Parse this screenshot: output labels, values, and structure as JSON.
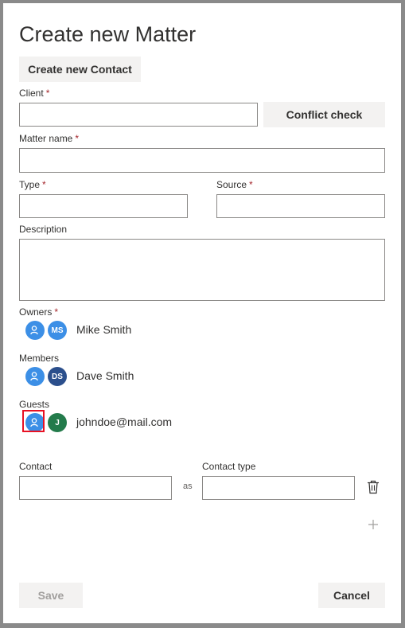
{
  "dialog": {
    "title": "Create new Matter",
    "create_contact_label": "Create new Contact",
    "conflict_check_label": "Conflict check",
    "save_label": "Save",
    "cancel_label": "Cancel"
  },
  "fields": {
    "client": {
      "label": "Client",
      "required_mark": "*",
      "value": ""
    },
    "matter_name": {
      "label": "Matter name",
      "required_mark": "*",
      "value": ""
    },
    "type": {
      "label": "Type",
      "required_mark": "*",
      "value": ""
    },
    "source": {
      "label": "Source",
      "required_mark": "*",
      "value": ""
    },
    "description": {
      "label": "Description",
      "value": ""
    },
    "contact": {
      "label": "Contact",
      "value": ""
    },
    "contact_type": {
      "label": "Contact type",
      "value": ""
    },
    "as_text": "as"
  },
  "people": {
    "owners": {
      "label": "Owners",
      "required_mark": "*",
      "initials": "MS",
      "name": "Mike Smith",
      "avatar_color": "#3c8fe6"
    },
    "members": {
      "label": "Members",
      "initials": "DS",
      "name": "Dave Smith",
      "avatar_color": "#2b4f8c"
    },
    "guests": {
      "label": "Guests",
      "initials": "J",
      "name": "johndoe@mail.com",
      "avatar_color": "#237b4b"
    }
  },
  "icons": {
    "add_person": "person-add-icon",
    "delete": "trash-icon",
    "add": "plus-icon"
  },
  "colors": {
    "required": "#a4262c",
    "highlight": "#e81123",
    "button_bg": "#f3f2f1"
  }
}
